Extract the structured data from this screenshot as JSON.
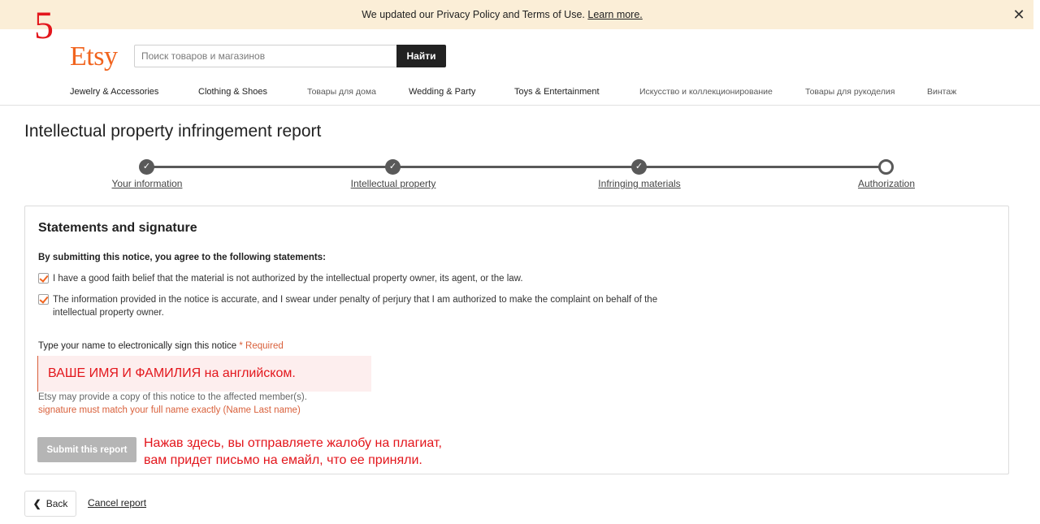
{
  "banner": {
    "text": "We updated our Privacy Policy and Terms of Use.",
    "link": "Learn more.",
    "close_icon": "close-icon"
  },
  "annotation": {
    "step_number": "5",
    "signature_hint": "ВАШЕ ИМЯ И ФАМИЛИЯ на английском.",
    "submit_hint_line1": "Нажав здесь, вы отправляете жалобу на плагиат,",
    "submit_hint_line2": "вам придет письмо на емайл, что ее приняли.",
    "color": "#e3161c"
  },
  "header": {
    "logo": "Etsy",
    "logo_color": "#f1641e",
    "search_placeholder": "Поиск товаров и магазинов",
    "search_button": "Найти"
  },
  "categories": [
    "Jewelry & Accessories",
    "Clothing & Shoes",
    "Товары для дома",
    "Wedding & Party",
    "Toys & Entertainment",
    "Искусство и коллекционирование",
    "Товары для рукоделия",
    "Винтаж"
  ],
  "page": {
    "title": "Intellectual property infringement report"
  },
  "steps": [
    {
      "label": "Your information",
      "state": "complete"
    },
    {
      "label": "Intellectual property",
      "state": "complete"
    },
    {
      "label": "Infringing materials",
      "state": "complete"
    },
    {
      "label": "Authorization",
      "state": "current"
    }
  ],
  "form": {
    "section_title": "Statements and signature",
    "intro": "By submitting this notice, you agree to the following statements:",
    "statements": [
      {
        "text": "I have a good faith belief that the material is not authorized by the intellectual property owner, its agent, or the law.",
        "checked": true
      },
      {
        "text": "The information provided in the notice is accurate, and I swear under penalty of perjury that I am authorized to make the complaint on behalf of the intellectual property owner.",
        "checked": true
      }
    ],
    "signature_label": "Type your name to electronically sign this notice",
    "required": "* Required",
    "help_text": "Etsy may provide a copy of this notice to the affected member(s).",
    "error_text": "signature must match your full name exactly (Name Last name)",
    "submit_label": "Submit this report"
  },
  "footer": {
    "back_label": "Back",
    "cancel_label": "Cancel report"
  }
}
